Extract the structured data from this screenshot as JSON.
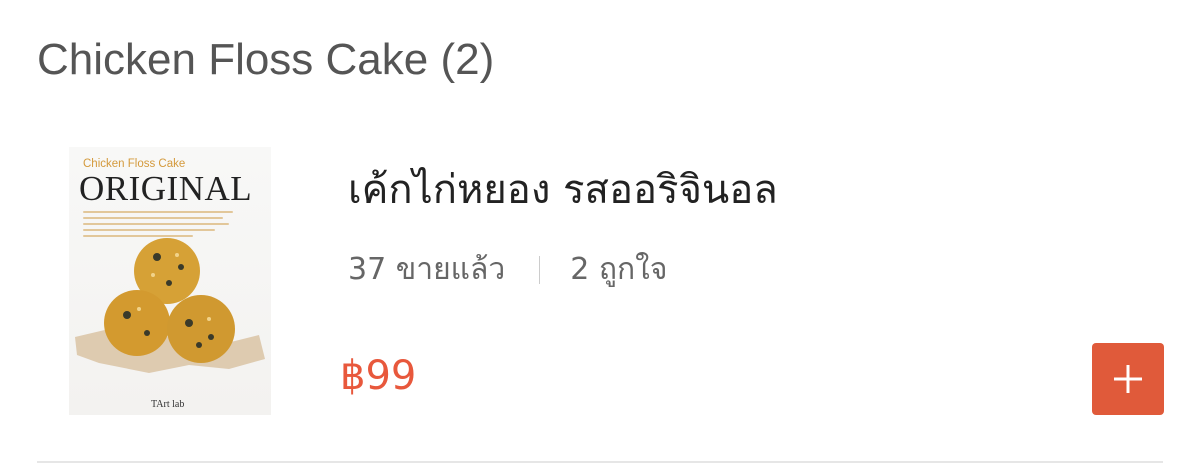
{
  "section": {
    "title": "Chicken Floss Cake (2)"
  },
  "product": {
    "image": {
      "subtitle": "Chicken Floss Cake",
      "title": "ORIGINAL",
      "brand": "TArt lab",
      "alt_icon": "chicken-floss-cake-photo"
    },
    "name": "เค้กไก่หยอง รสออริจินอล",
    "sold_count": "37 ขายแล้ว",
    "likes": "2 ถูกใจ",
    "price": "฿99",
    "add_button_icon": "plus-icon"
  },
  "colors": {
    "price": "#e8583c",
    "add_button": "#e05a3a",
    "title": "#555555",
    "name": "#222222",
    "meta": "#666666"
  }
}
